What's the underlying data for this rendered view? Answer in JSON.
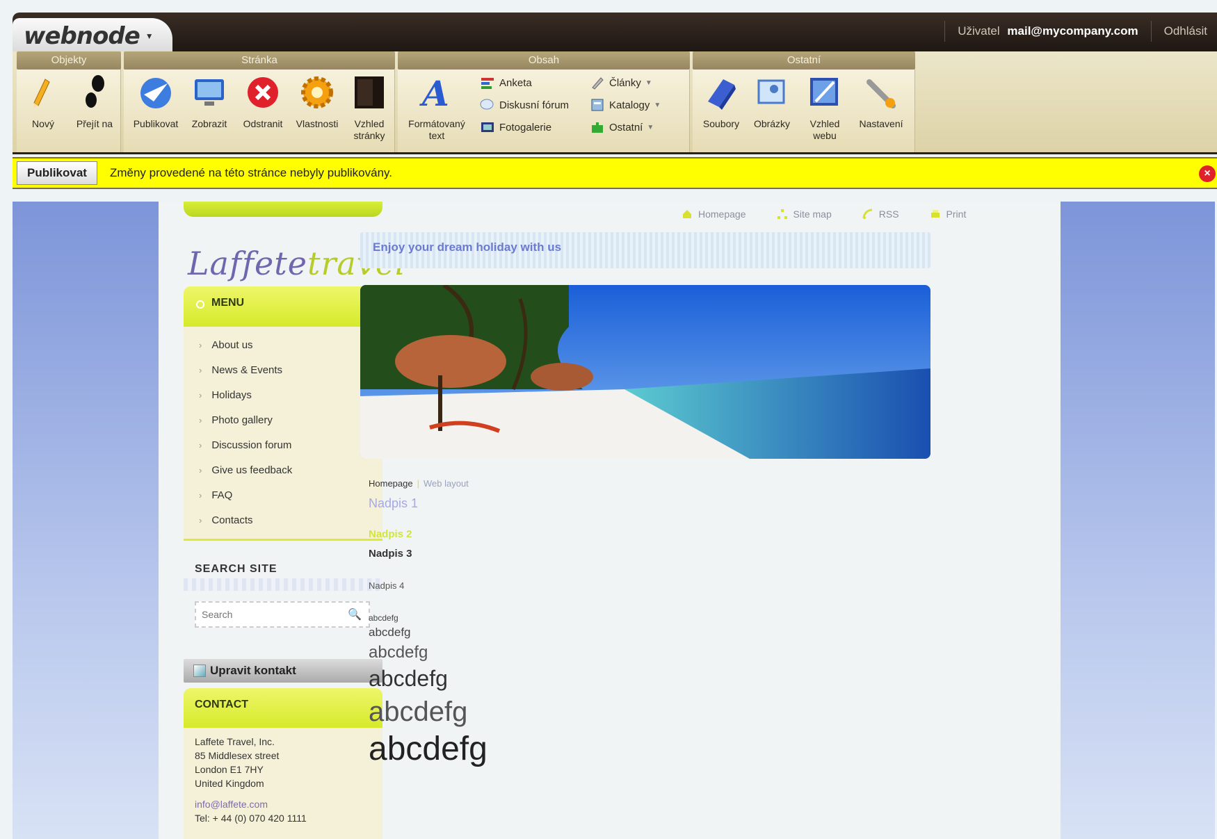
{
  "topbar": {
    "logo": "webnode",
    "user_label": "Uživatel",
    "user_email": "mail@mycompany.com",
    "logout": "Odhlásit"
  },
  "ribbon": {
    "groups": [
      {
        "title": "Objekty",
        "buttons": [
          "Nový",
          "Přejít na"
        ]
      },
      {
        "title": "Stránka",
        "buttons": [
          "Publikovat",
          "Zobrazit",
          "Odstranit",
          "Vlastnosti",
          "Vzhled stránky"
        ]
      },
      {
        "title": "Obsah",
        "big_button": "Formátovaný text",
        "small_buttons": [
          "Anketa",
          "Diskusní fórum",
          "Fotogalerie",
          "Články",
          "Katalogy",
          "Ostatní"
        ]
      },
      {
        "title": "Ostatní",
        "buttons": [
          "Soubory",
          "Obrázky",
          "Vzhled webu",
          "Nastavení"
        ]
      }
    ]
  },
  "publish_bar": {
    "button": "Publikovat",
    "message": "Změny provedené na této stránce nebyly publikovány."
  },
  "site": {
    "logo_left": "Laffete",
    "logo_right": "travel",
    "menu_title": "MENU",
    "menu_items": [
      "About us",
      "News & Events",
      "Holidays",
      "Photo gallery",
      "Discussion forum",
      "Give us feedback",
      "FAQ",
      "Contacts"
    ],
    "search_title": "SEARCH SITE",
    "search_placeholder": "Search",
    "edit_contact": "Upravit kontakt",
    "contact_title": "CONTACT",
    "contact_lines": [
      "Laffete Travel, Inc.",
      "85 Middlesex street",
      "London E1 7HY",
      "United Kingdom"
    ],
    "contact_email": "info@laffete.com",
    "contact_tel": "Tel: + 44 (0) 070 420 1111",
    "top_links": [
      "Homepage",
      "Site map",
      "RSS",
      "Print"
    ],
    "slogan": "Enjoy your dream holiday with us",
    "breadcrumb_home": "Homepage",
    "breadcrumb_current": "Web layout",
    "headings": [
      "Nadpis 1",
      "Nadpis 2",
      "Nadpis 3",
      "Nadpis 4"
    ],
    "samples": [
      "abcdefg",
      "abcdefg",
      "abcdefg",
      "abcdefg",
      "abcdefg",
      "abcdefg"
    ]
  },
  "colors": {
    "accent_yellow": "#ffff00",
    "menu_green": "#d6ea2a",
    "slogan_blue": "#6a7bd0"
  }
}
